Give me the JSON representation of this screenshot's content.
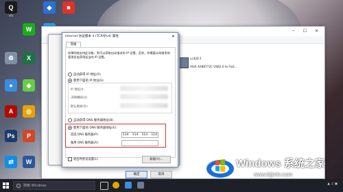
{
  "desktop_icons": [
    {
      "label": "QQ",
      "name": "qq-icon",
      "color": "#1a1a1a",
      "glyph": "Q"
    },
    {
      "label": "",
      "name": "app-icon",
      "color": "#2f6fd6",
      "glyph": "◆"
    },
    {
      "label": "",
      "name": "app-icon-2",
      "color": "#e0322a",
      "glyph": "■"
    },
    {
      "label": "",
      "name": "wechat-icon",
      "color": "#1aad19",
      "glyph": "W"
    },
    {
      "label": "",
      "name": "app-icon-3",
      "color": "#30a0ff",
      "glyph": "▣"
    },
    {
      "label": "",
      "name": "recycle-bin-icon",
      "color": "#7f8fa6",
      "glyph": "♻"
    },
    {
      "label": "",
      "name": "excel-icon",
      "color": "#1e7145",
      "glyph": "X"
    },
    {
      "label": "",
      "name": "app-icon-4",
      "color": "#3b8de0",
      "glyph": "●"
    },
    {
      "label": "",
      "name": "app-icon-5",
      "color": "#6c4",
      "glyph": "◈"
    },
    {
      "label": "",
      "name": "adobe-icon",
      "color": "#b30b00",
      "glyph": "A"
    },
    {
      "label": "",
      "name": "chrome-icon",
      "color": "#e7a300",
      "glyph": "◎"
    },
    {
      "label": "",
      "name": "photoshop-icon",
      "color": "#1c3b6a",
      "glyph": "Ps"
    },
    {
      "label": "",
      "name": "powerpoint-icon",
      "color": "#d24726",
      "glyph": "P"
    },
    {
      "label": "",
      "name": "teamviewer-icon",
      "color": "#0e8ee9",
      "glyph": "⇄"
    },
    {
      "label": "",
      "name": "word-icon",
      "color": "#2b579a",
      "glyph": "W"
    }
  ],
  "netwin": {
    "adapter_line1": "以太网 2",
    "adapter_line2": "",
    "adapter_line3": "ASIX AX88772C USB2.0 to Fast..."
  },
  "dialog": {
    "title": "Internet 协议版本 4 (TCP/IPv4) 属性",
    "tab": "常规",
    "description": "如果网络支持此功能，则可以获取自动指派的 IP 设置。否则，你需要从网络系统管理员处获得适当的 IP 设置。",
    "auto_ip": "自动获得 IP 地址(O)",
    "manual_ip": "使用下面的 IP 地址(S):",
    "ip_label": "IP 地址(I):",
    "mask_label": "子网掩码(U):",
    "gateway_label": "默认网关(D):",
    "auto_dns": "自动获得 DNS 服务器地址(B)",
    "manual_dns": "使用下面的 DNS 服务器地址(E):",
    "pref_dns_label": "首选 DNS 服务器(P):",
    "pref_dns_value": [
      "114",
      "114",
      "114",
      "114"
    ],
    "alt_dns_label": "备用 DNS 服务器(A):",
    "alt_dns_value": [
      ".",
      ".",
      "."
    ],
    "validate": "退出时验证设置(L)",
    "advanced": "高级(V)...",
    "ok": "确定",
    "cancel": "取消"
  },
  "taskbar": {
    "search_placeholder": "搜索 Windows"
  },
  "watermark": {
    "brand": "Windows 系统之家",
    "url": "www.bjjmlv.com"
  }
}
